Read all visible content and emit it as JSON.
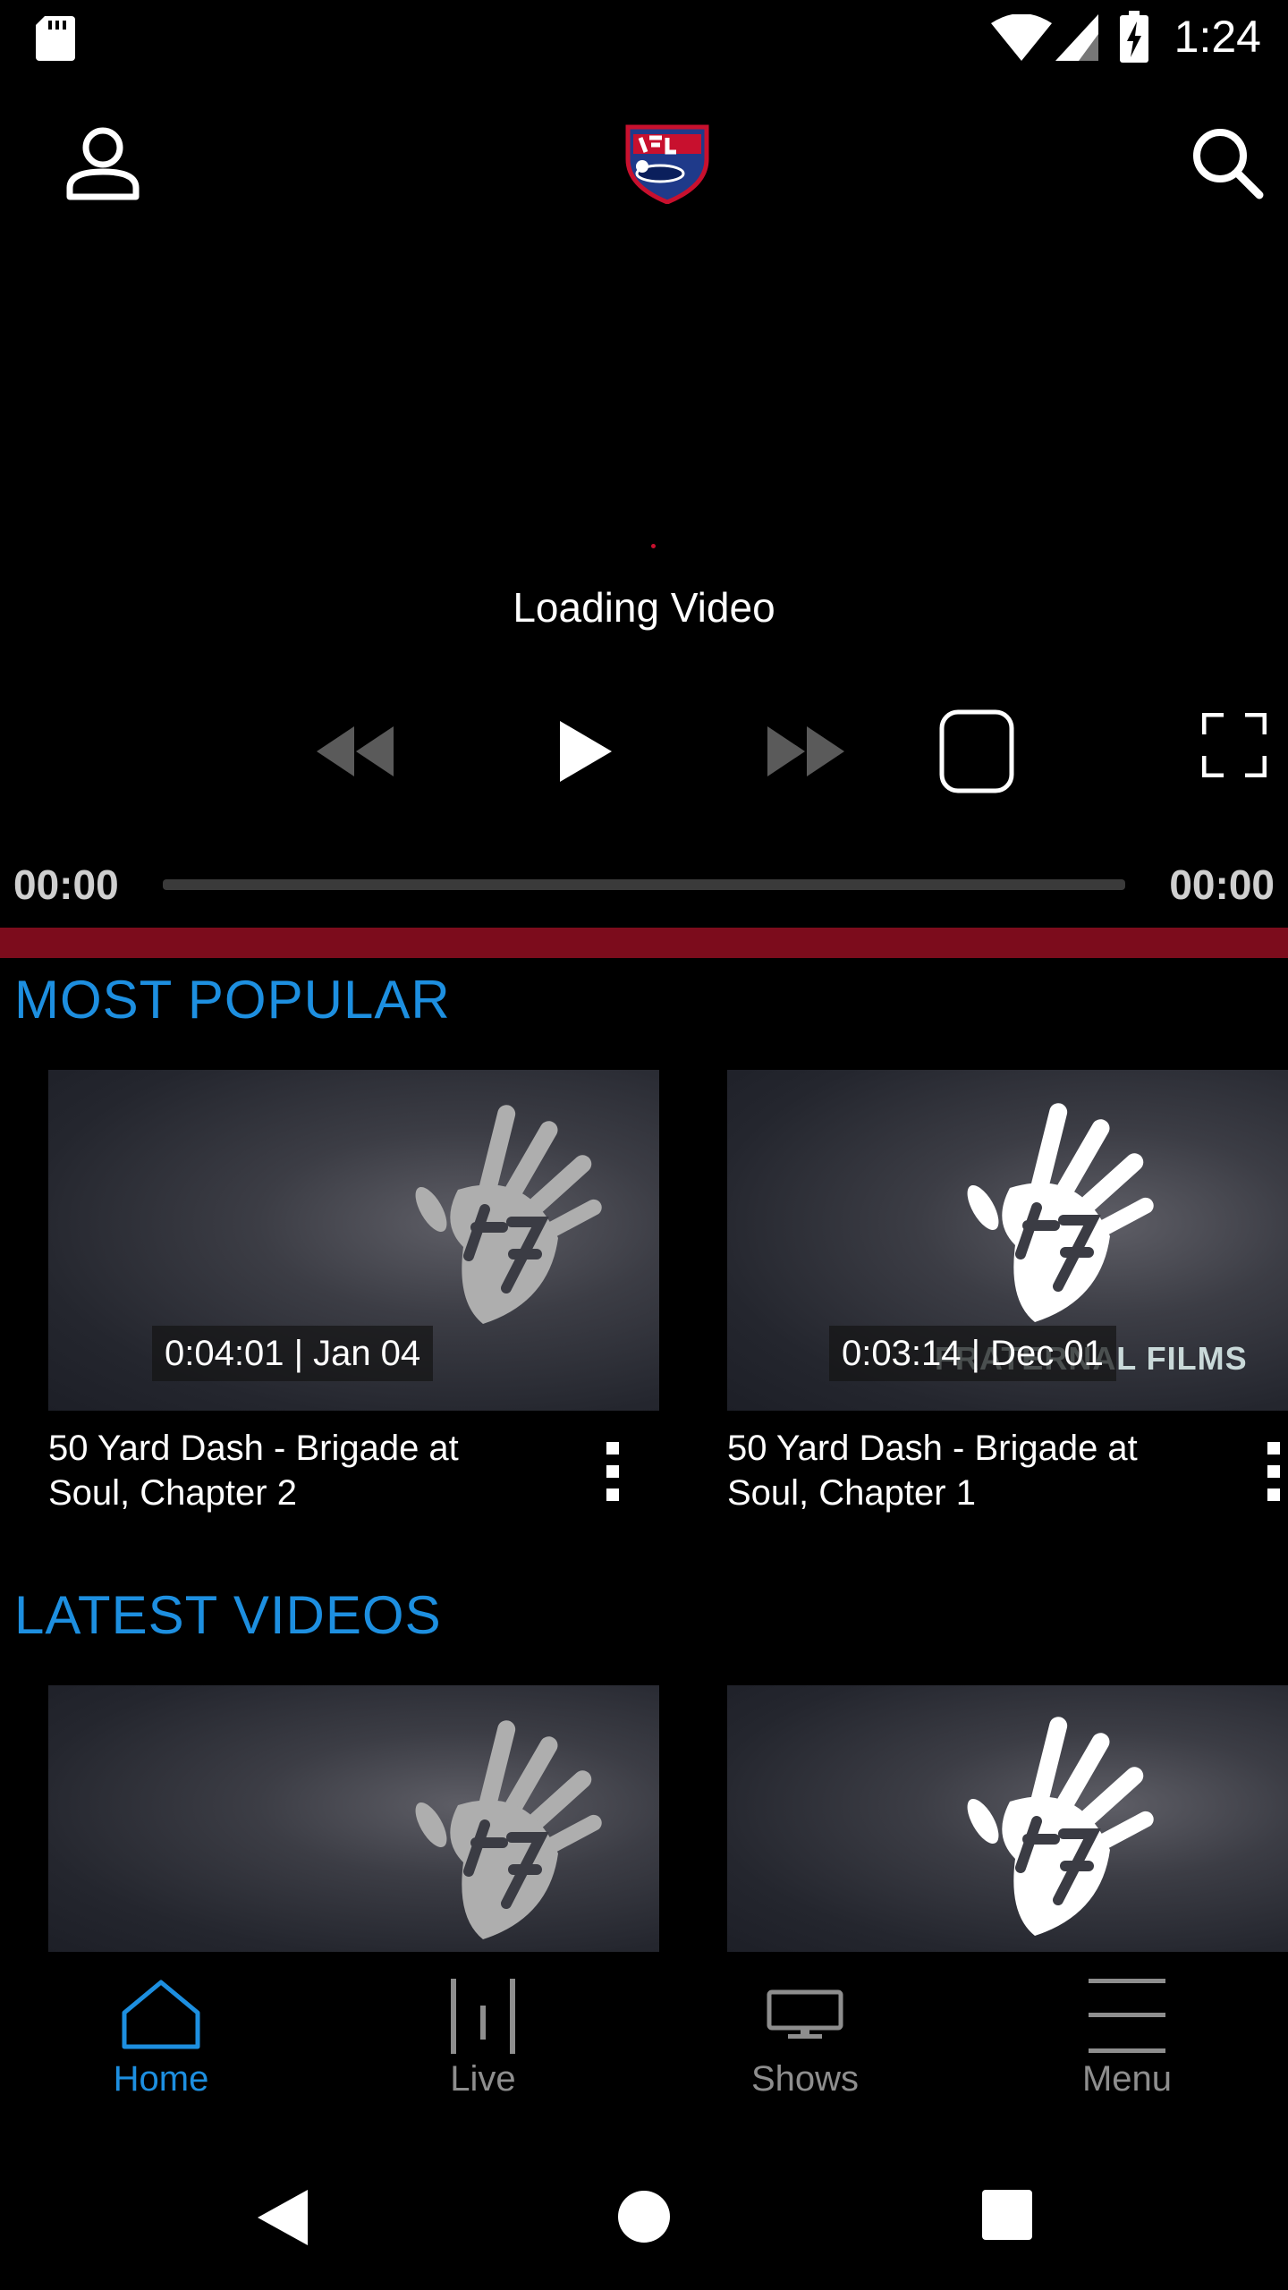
{
  "status_bar": {
    "time": "1:24"
  },
  "player": {
    "loading_text": "Loading Video",
    "time_current": "00:00",
    "time_total": "00:00"
  },
  "sections": {
    "most_popular": {
      "title": "MOST POPULAR",
      "cards": [
        {
          "duration": "0:04:01 | Jan 04",
          "title": "50 Yard Dash - Brigade at Soul, Chapter 2"
        },
        {
          "duration": "0:03:14 | Dec 01",
          "title": "50 Yard Dash - Brigade at Soul, Chapter 1"
        }
      ]
    },
    "latest_videos": {
      "title": "LATEST VIDEOS"
    }
  },
  "thumbnail_watermark": "FRATERNAL FILMS",
  "bottom_nav": {
    "items": [
      {
        "label": "Home",
        "icon": "home-icon",
        "active": true
      },
      {
        "label": "Live",
        "icon": "live-icon",
        "active": false
      },
      {
        "label": "Shows",
        "icon": "tv-icon",
        "active": false
      },
      {
        "label": "Menu",
        "icon": "menu-icon",
        "active": false
      }
    ]
  },
  "colors": {
    "accent": "#1d8fe0",
    "divider_red": "#7c0c1c",
    "inactive": "#8e8e8e"
  }
}
